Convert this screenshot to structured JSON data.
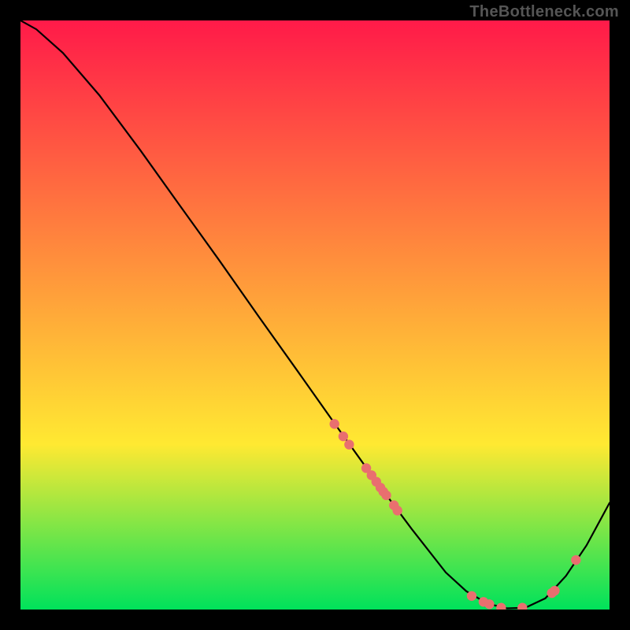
{
  "watermark": "TheBottleneck.com",
  "chart_data": {
    "type": "line",
    "title": "",
    "xlabel": "",
    "ylabel": "",
    "xlim": [
      0,
      100
    ],
    "ylim": [
      0,
      100
    ],
    "grid": false,
    "legend": false,
    "background_gradient": {
      "top": "#ff1a49",
      "mid": "#ffe932",
      "bottom": "#00e25b"
    },
    "series": [
      {
        "name": "bottleneck-curve",
        "color": "#000000",
        "x": [
          0.0,
          2.7,
          7.2,
          13.4,
          20.4,
          26.9,
          33.8,
          40.4,
          47.1,
          53.6,
          60.2,
          66.4,
          72.2,
          75.7,
          79.3,
          82.6,
          85.7,
          89.1,
          92.6,
          96.1,
          100.0
        ],
        "y": [
          100.0,
          98.5,
          94.5,
          87.3,
          77.9,
          68.8,
          59.2,
          49.8,
          40.4,
          31.2,
          22.0,
          13.7,
          6.3,
          3.1,
          1.0,
          0.2,
          0.3,
          1.9,
          5.7,
          10.9,
          18.1
        ]
      }
    ],
    "scatter": [
      {
        "name": "marker-dots",
        "color": "#e96f6f",
        "radius": 6.2,
        "x": [
          53.3,
          54.8,
          55.8,
          58.7,
          59.6,
          60.4,
          61.1,
          61.6,
          62.1,
          63.4,
          64.0,
          76.6,
          78.6,
          79.6,
          81.6,
          85.2,
          90.2,
          90.7,
          94.3
        ],
        "y": [
          31.5,
          29.4,
          28.0,
          24.0,
          22.8,
          21.7,
          20.7,
          20.0,
          19.4,
          17.7,
          16.8,
          2.3,
          1.3,
          0.9,
          0.3,
          0.3,
          2.8,
          3.2,
          8.4
        ]
      }
    ]
  }
}
